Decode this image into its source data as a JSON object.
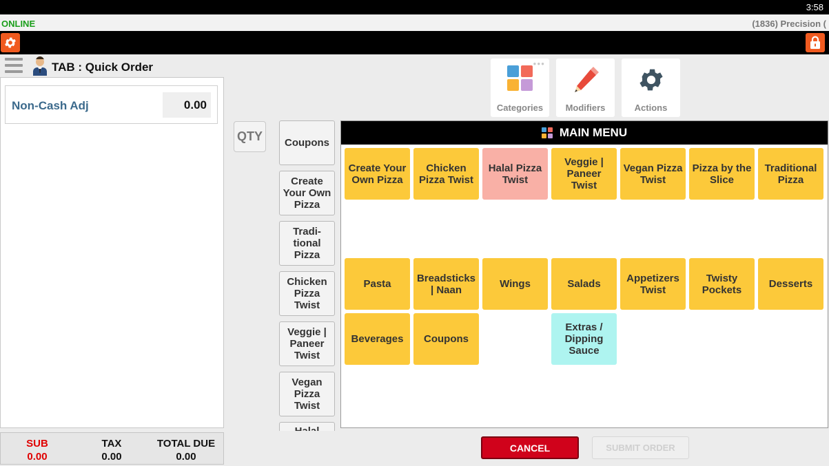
{
  "status_bar": {
    "time": "3:58"
  },
  "info_bar": {
    "connection": "ONLINE",
    "store": "(1836) Precision ("
  },
  "header": {
    "title": "TAB : Quick Order"
  },
  "order": {
    "lines": [
      {
        "name": "Non-Cash Adj",
        "amount": "0.00"
      }
    ]
  },
  "totals": {
    "sub_label": "SUB",
    "sub_value": "0.00",
    "tax_label": "TAX",
    "tax_value": "0.00",
    "due_label": "TOTAL DUE",
    "due_value": "0.00"
  },
  "qty_label": "QTY",
  "category_column": [
    "Coupons",
    "Create Your Own Pizza",
    "Tradi-tional Pizza",
    "Chicken Pizza Twist",
    "Veggie | Paneer Twist",
    "Vegan Pizza Twist",
    "Halal"
  ],
  "top_tiles": {
    "categories": "Categories",
    "modifiers": "Modifiers",
    "actions": "Actions"
  },
  "menu": {
    "title": "MAIN MENU",
    "items": [
      {
        "label": "Create Your Own Pizza",
        "color": "#fcc93a"
      },
      {
        "label": "Chicken Pizza Twist",
        "color": "#fcc93a"
      },
      {
        "label": "Halal Pizza Twist",
        "color": "#f9b0a6"
      },
      {
        "label": "Veggie | Paneer Twist",
        "color": "#fcc93a"
      },
      {
        "label": "Vegan Pizza Twist",
        "color": "#fcc93a"
      },
      {
        "label": "Pizza by the Slice",
        "color": "#fcc93a"
      },
      {
        "label": "Traditional Pizza",
        "color": "#fcc93a"
      },
      {
        "label": "Pasta",
        "color": "#fcc93a"
      },
      {
        "label": "Breadsticks | Naan",
        "color": "#fcc93a"
      },
      {
        "label": "Wings",
        "color": "#fcc93a"
      },
      {
        "label": "Salads",
        "color": "#fcc93a"
      },
      {
        "label": "Appetizers Twist",
        "color": "#fcc93a"
      },
      {
        "label": "Twisty Pockets",
        "color": "#fcc93a"
      },
      {
        "label": "Desserts",
        "color": "#fcc93a"
      },
      {
        "label": "Beverages",
        "color": "#fcc93a"
      },
      {
        "label": "Coupons",
        "color": "#fcc93a"
      },
      {
        "label": "Extras / Dipping Sauce",
        "color": "#aef4f0"
      }
    ]
  },
  "actions": {
    "cancel": "CANCEL",
    "submit": "SUBMIT ORDER"
  },
  "colors": {
    "accent_orange": "#f05a1f",
    "cancel_red": "#d0021b",
    "online_green": "#1a9e1a",
    "sub_red": "#e00000"
  }
}
